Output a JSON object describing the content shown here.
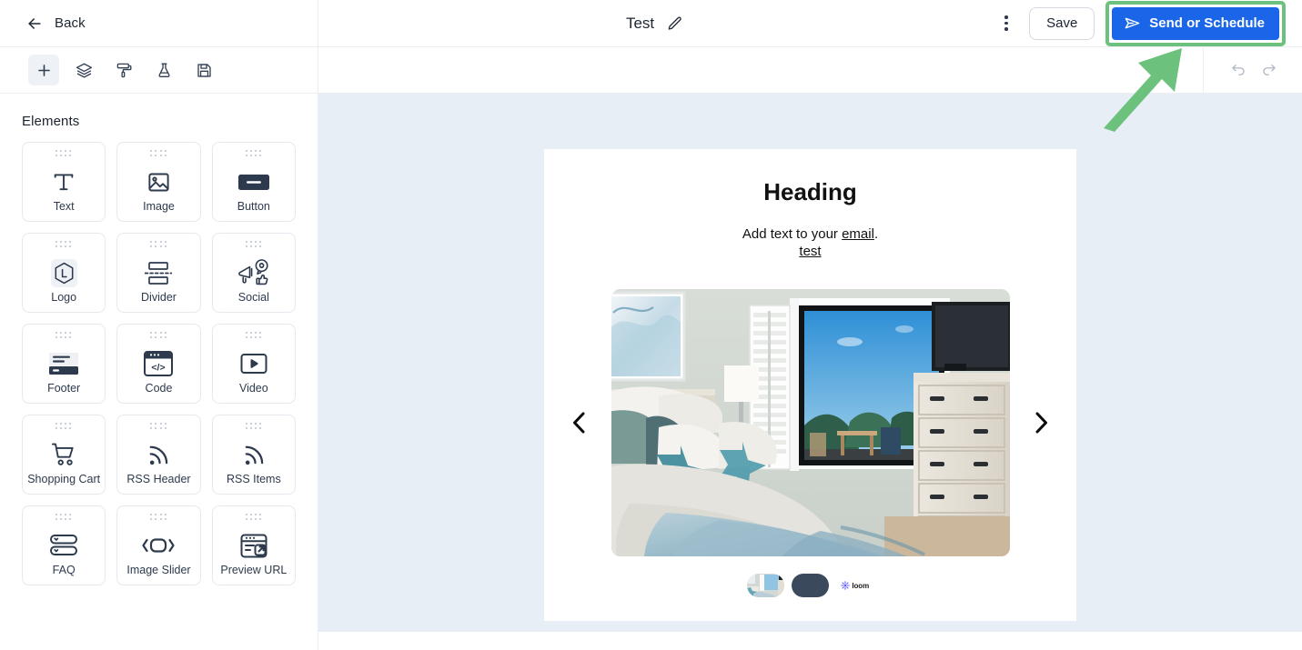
{
  "header": {
    "back_label": "Back",
    "back_icon": "arrow-left-icon",
    "doc_title": "Test",
    "edit_icon": "pencil-icon",
    "more_icon": "kebab-menu-icon",
    "save_label": "Save",
    "send_label": "Send or Schedule",
    "send_icon": "paper-plane-icon",
    "send_highlight_color": "#6cc27d",
    "send_button_color": "#1a65e8"
  },
  "left_panel": {
    "toolbar": [
      {
        "name": "add-element-tool",
        "icon": "plus-icon",
        "active": true
      },
      {
        "name": "layers-tool",
        "icon": "layers-icon",
        "active": false
      },
      {
        "name": "styles-tool",
        "icon": "paint-roller-icon",
        "active": false
      },
      {
        "name": "test-tool",
        "icon": "flask-icon",
        "active": false
      },
      {
        "name": "save-template-tool",
        "icon": "floppy-disk-icon",
        "active": false
      }
    ],
    "section_title": "Elements",
    "elements": [
      {
        "label": "Text",
        "icon": "text-icon"
      },
      {
        "label": "Image",
        "icon": "image-icon"
      },
      {
        "label": "Button",
        "icon": "button-icon"
      },
      {
        "label": "Logo",
        "icon": "logo-icon"
      },
      {
        "label": "Divider",
        "icon": "divider-icon"
      },
      {
        "label": "Social",
        "icon": "social-icon"
      },
      {
        "label": "Footer",
        "icon": "footer-icon"
      },
      {
        "label": "Code",
        "icon": "code-icon"
      },
      {
        "label": "Video",
        "icon": "video-icon"
      },
      {
        "label": "Shopping Cart",
        "icon": "shopping-cart-icon"
      },
      {
        "label": "RSS Header",
        "icon": "rss-icon"
      },
      {
        "label": "RSS Items",
        "icon": "rss-icon"
      },
      {
        "label": "FAQ",
        "icon": "faq-icon"
      },
      {
        "label": "Image Slider",
        "icon": "image-slider-icon"
      },
      {
        "label": "Preview URL",
        "icon": "preview-url-icon"
      }
    ]
  },
  "canvas": {
    "undo_icon": "undo-icon",
    "redo_icon": "redo-icon",
    "background_color": "#e8eef6",
    "email": {
      "heading": "Heading",
      "paragraph_before": "Add text to your ",
      "paragraph_link": "email",
      "paragraph_after": ".",
      "second_line_link": "test",
      "slider": {
        "prev_icon": "chevron-left-icon",
        "next_icon": "chevron-right-icon",
        "active_slide": 1,
        "slides": [
          {
            "name": "bedroom-photo-slide",
            "type": "photo"
          },
          {
            "name": "dark-slide",
            "type": "solid",
            "color": "#3a4a5c"
          },
          {
            "name": "loom-slide",
            "type": "logo",
            "logo_text": "loom"
          }
        ]
      }
    }
  },
  "annotation": {
    "arrow_color": "#6cc27d",
    "points_to": "send-or-schedule-button"
  }
}
